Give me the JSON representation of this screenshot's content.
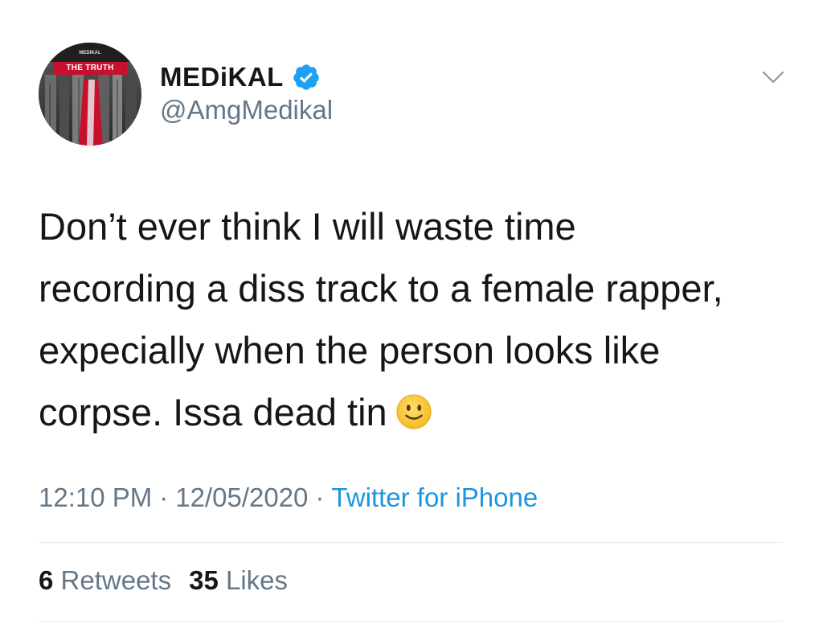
{
  "author": {
    "display_name": "MEDiKAL",
    "handle": "@AmgMedikal",
    "verified": true,
    "avatar_caption": "THE TRUTH",
    "avatar_small_text": "MEDIKAL"
  },
  "tweet": {
    "lines": [
      "Don’t ever think I will waste time",
      "recording a diss track to a female rapper,",
      "expecially when the person looks like",
      "corpse. Issa dead tin"
    ],
    "emoji": "slightly-smiling-face"
  },
  "meta": {
    "time": "12:10 PM",
    "separator": "·",
    "date": "12/05/2020",
    "source": "Twitter for iPhone"
  },
  "stats": {
    "retweets_count": "6",
    "retweets_label": "Retweets",
    "likes_count": "35",
    "likes_label": "Likes"
  },
  "icons": {
    "verified": "verified-badge-icon",
    "menu": "chevron-down-icon"
  },
  "colors": {
    "text_primary": "#14171a",
    "text_secondary": "#657786",
    "link": "#1b95e0",
    "verified": "#1da1f2",
    "divider": "#e1e8ed",
    "avatar_red": "#c8102e"
  }
}
